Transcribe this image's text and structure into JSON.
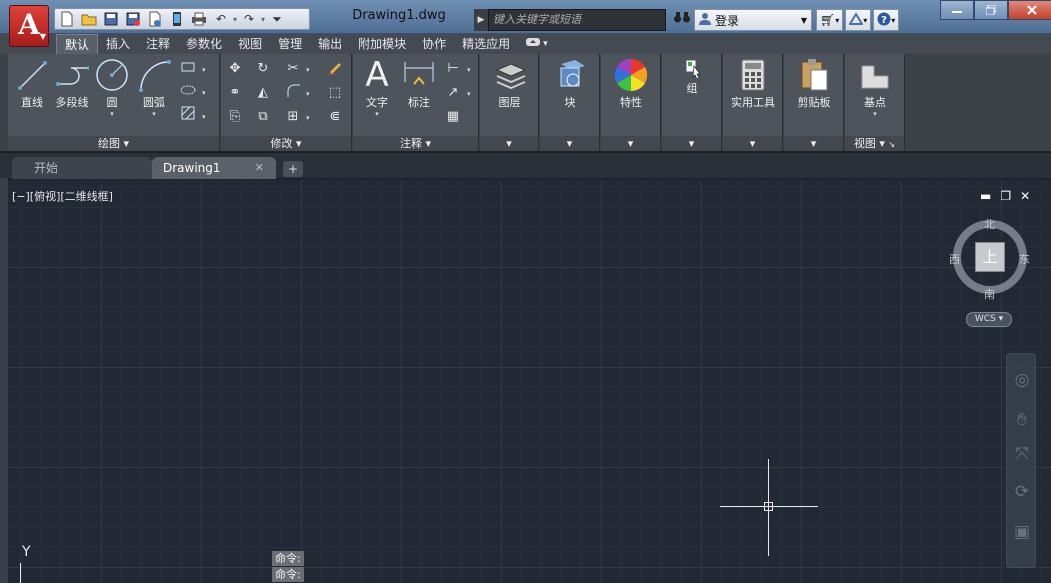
{
  "app": {
    "logo_letter": "A",
    "document_title": "Drawing1.dwg",
    "search_placeholder": "键入关键字或短语",
    "login_label": "登录"
  },
  "ribbon_tabs": [
    "默认",
    "插入",
    "注释",
    "参数化",
    "视图",
    "管理",
    "输出",
    "附加模块",
    "协作",
    "精选应用"
  ],
  "panels": {
    "draw": {
      "title": "绘图",
      "buttons": {
        "line": "直线",
        "polyline": "多段线",
        "circle": "圆",
        "arc": "圆弧"
      }
    },
    "modify": {
      "title": "修改"
    },
    "annotation": {
      "title": "注释",
      "buttons": {
        "text": "文字",
        "dimension": "标注"
      }
    },
    "layers": {
      "label": "图层"
    },
    "block": {
      "label": "块"
    },
    "properties": {
      "label": "特性"
    },
    "groups": {
      "label": "组"
    },
    "utilities": {
      "label": "实用工具"
    },
    "clipboard": {
      "label": "剪贴板"
    },
    "view": {
      "label": "基点",
      "title": "视图"
    }
  },
  "doc_tabs": {
    "start": "开始",
    "drawing": "Drawing1"
  },
  "viewport": {
    "label": "[−][俯视][二维线框]",
    "compass": {
      "north": "北",
      "south": "南",
      "east": "东",
      "west": "西",
      "top_face": "上"
    },
    "wcs_label": "WCS"
  },
  "ucs": {
    "y_label": "Y"
  },
  "command_history": [
    "命令:",
    "命令:"
  ],
  "colors": {
    "canvas_bg": "#222834",
    "ribbon_bg": "#4e545b",
    "title_bar": "#5a7aa0",
    "app_button": "#c8302b"
  }
}
